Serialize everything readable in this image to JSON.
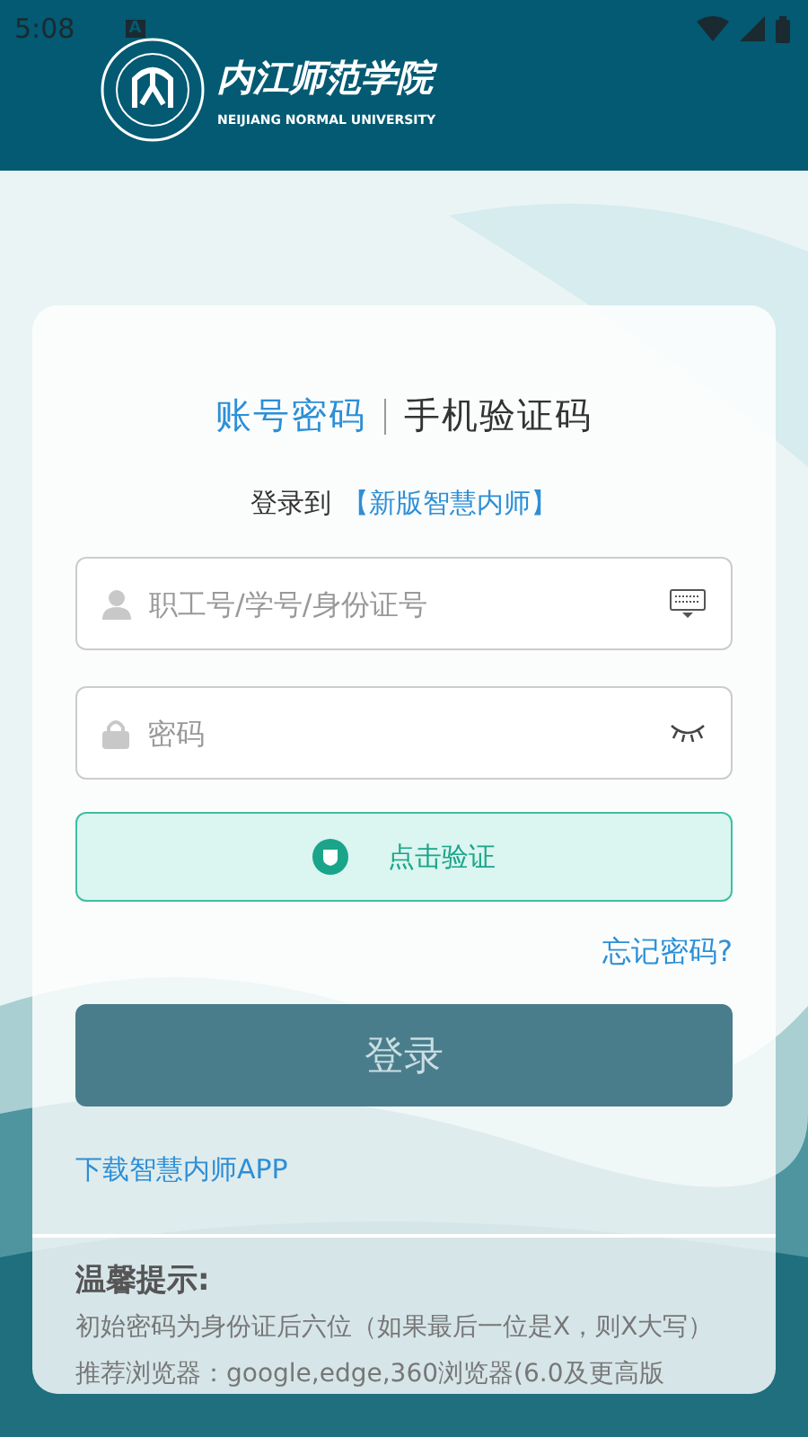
{
  "status_bar": {
    "time": "5:08",
    "notification": "A"
  },
  "header": {
    "school_name": "内江师范学院",
    "school_name_en": "NEIJIANG NORMAL UNIVERSITY"
  },
  "tabs": [
    {
      "label": "账号密码",
      "selected": true
    },
    {
      "label": "手机验证码",
      "selected": false
    }
  ],
  "login_to": {
    "prefix": "登录到",
    "target": "【新版智慧内师】"
  },
  "fields": [
    {
      "kind": "user",
      "placeholder": "职工号/学号/身份证号"
    },
    {
      "kind": "password",
      "placeholder": "密码"
    }
  ],
  "verify_button": "点击验证",
  "forgot_link": "忘记密码?",
  "login_button": "登录",
  "download_link": "下载智慧内师APP",
  "tips": {
    "title": "温馨提示:",
    "lines": [
      "初始密码为身份证后六位（如果最后一位是X，则X大写）",
      "推荐浏览器：google,edge,360浏览器(6.0及更高版"
    ]
  }
}
